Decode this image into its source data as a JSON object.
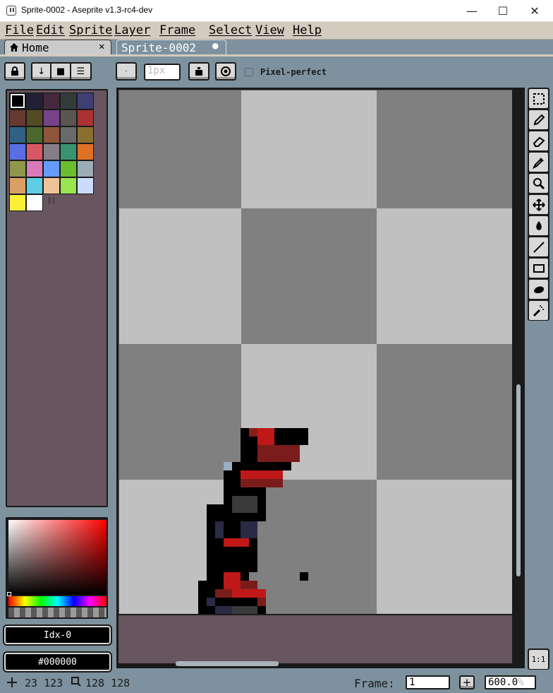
{
  "window": {
    "title": "Sprite-0002 - Aseprite v1.3-rc4-dev",
    "minimize_glyph": "—",
    "maximize_glyph": "☐",
    "close_glyph": "✕"
  },
  "menu": [
    "File",
    "Edit",
    "Sprite",
    "Layer",
    "Frame",
    "Select",
    "View",
    "Help"
  ],
  "tabs": {
    "home": {
      "label": "Home",
      "close_glyph": "✕"
    },
    "sprite": {
      "label": "Sprite-0002",
      "modified_glyph": "●"
    }
  },
  "context_bar": {
    "brush_size": "1px",
    "pixel_perfect_label": "Pixel-perfect",
    "pixel_perfect_checked": false
  },
  "palette": {
    "colors": [
      "#000000",
      "#222034",
      "#45283c",
      "#323c39",
      "#3f3f74",
      "#663931",
      "#524b24",
      "#76428a",
      "#595652",
      "#ac3232",
      "#306082",
      "#4b692f",
      "#8f563b",
      "#696a6a",
      "#8a6f30",
      "#5b6ee1",
      "#d95763",
      "#847e87",
      "#37946e",
      "#df7126",
      "#8f974a",
      "#d77bba",
      "#639bff",
      "#6abe30",
      "#9badb7",
      "#d9a066",
      "#5fcde4",
      "#eec39a",
      "#99e550",
      "#cbdbfc",
      "#fbf236",
      "#ffffff"
    ],
    "selected_index": 0
  },
  "color_info": {
    "index_label": "Idx-0",
    "hex_label": "#000000"
  },
  "status": {
    "cursor_pos": "23 123",
    "sprite_size": "128 128",
    "frame_label": "Frame:",
    "frame_value": "1",
    "zoom_value": "600.0",
    "zoom_unit": "%",
    "add_frame_glyph": "+",
    "zoom_reset_label": "1:1"
  },
  "tools": [
    "rectangular-marquee",
    "pencil",
    "eraser",
    "eyedropper",
    "zoom",
    "move",
    "paint-bucket",
    "line",
    "rectangle",
    "contour",
    "spray"
  ]
}
